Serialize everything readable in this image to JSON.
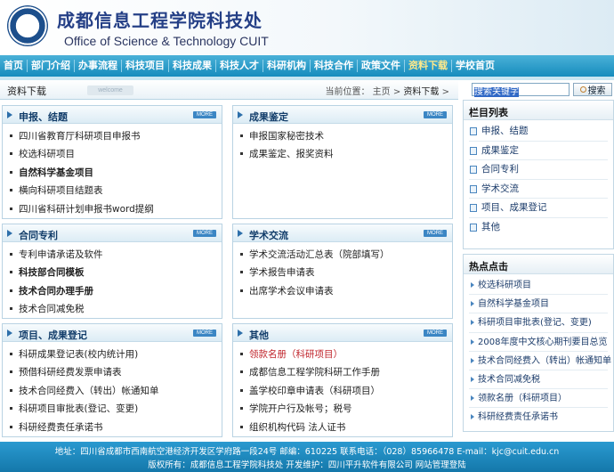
{
  "header": {
    "logo_text": "CUIT",
    "site_name_cn": "成都信息工程学院科技处",
    "site_name_en": "Office of Science & Technology CUIT"
  },
  "nav": {
    "items": [
      "首页",
      "部门介绍",
      "办事流程",
      "科技项目",
      "科技成果",
      "科技人才",
      "科研机构",
      "科技合作",
      "政策文件",
      "资料下载",
      "学校首页"
    ],
    "active_index": 9
  },
  "breadcrumb": {
    "title": "资料下载",
    "welcome": "welcome",
    "location_label": "当前位置：",
    "path": [
      "主页",
      "资料下载"
    ],
    "separator": ">"
  },
  "search": {
    "value": "搜索关键字",
    "button_label": "搜索"
  },
  "more_label": "MORE",
  "sections": [
    {
      "title": "申报、结题",
      "items": [
        {
          "text": "四川省教育厅科研项目申报书",
          "style": "normal"
        },
        {
          "text": "校选科研项目",
          "style": "normal"
        },
        {
          "text": "自然科学基金项目",
          "style": "bold"
        },
        {
          "text": "横向科研项目结题表",
          "style": "normal"
        },
        {
          "text": "四川省科研计划申报书word提纲",
          "style": "normal"
        }
      ]
    },
    {
      "title": "成果鉴定",
      "items": [
        {
          "text": "申报国家秘密技术",
          "style": "normal"
        },
        {
          "text": "成果鉴定、报奖资料",
          "style": "normal"
        }
      ]
    },
    {
      "title": "合同专利",
      "items": [
        {
          "text": "专利申请承诺及软件",
          "style": "normal"
        },
        {
          "text": "科技部合同模板",
          "style": "bold"
        },
        {
          "text": "技术合同办理手册",
          "style": "bold"
        },
        {
          "text": "技术合同减免税",
          "style": "normal"
        }
      ]
    },
    {
      "title": "学术交流",
      "items": [
        {
          "text": "学术交流活动汇总表（院部填写）",
          "style": "normal"
        },
        {
          "text": "学术报告申请表",
          "style": "normal"
        },
        {
          "text": "出席学术会议申请表",
          "style": "normal"
        }
      ]
    },
    {
      "title": "项目、成果登记",
      "items": [
        {
          "text": "科研成果登记表(校内统计用)",
          "style": "normal"
        },
        {
          "text": "预借科研经费发票申请表",
          "style": "normal"
        },
        {
          "text": "技术合同经费入（转出）帐通知单",
          "style": "normal"
        },
        {
          "text": "科研项目审批表(登记、变更)",
          "style": "normal"
        },
        {
          "text": "科研经费责任承诺书",
          "style": "normal"
        }
      ]
    },
    {
      "title": "其他",
      "items": [
        {
          "text": "领款名册（科研项目）",
          "style": "red"
        },
        {
          "text": "成都信息工程学院科研工作手册",
          "style": "normal"
        },
        {
          "text": "盖学校印章申请表（科研项目）",
          "style": "normal"
        },
        {
          "text": "学院开户行及帐号；税号",
          "style": "normal"
        },
        {
          "text": "组织机构代码 法人证书",
          "style": "normal"
        }
      ]
    }
  ],
  "sidebar": {
    "columns_title": "栏目列表",
    "columns": [
      "申报、结题",
      "成果鉴定",
      "合同专利",
      "学术交流",
      "项目、成果登记",
      "其他"
    ],
    "hot_title": "热点点击",
    "hot": [
      "校选科研项目",
      "自然科学基金项目",
      "科研项目审批表(登记、变更)",
      "2008年度中文核心期刊要目总览",
      "技术合同经费入（转出）帐通知单",
      "技术合同减免税",
      "领款名册（科研项目）",
      "科研经费责任承诺书"
    ]
  },
  "footer": {
    "line1": "地址：四川省成都市西南航空港经济开发区学府路一段24号   邮编：610225   联系电话：（028）85966478   E-mail：kjc@cuit.edu.cn",
    "line2": "版权所有：成都信息工程学院科技处   开发维护：四川平升软件有限公司   网站管理登陆"
  }
}
